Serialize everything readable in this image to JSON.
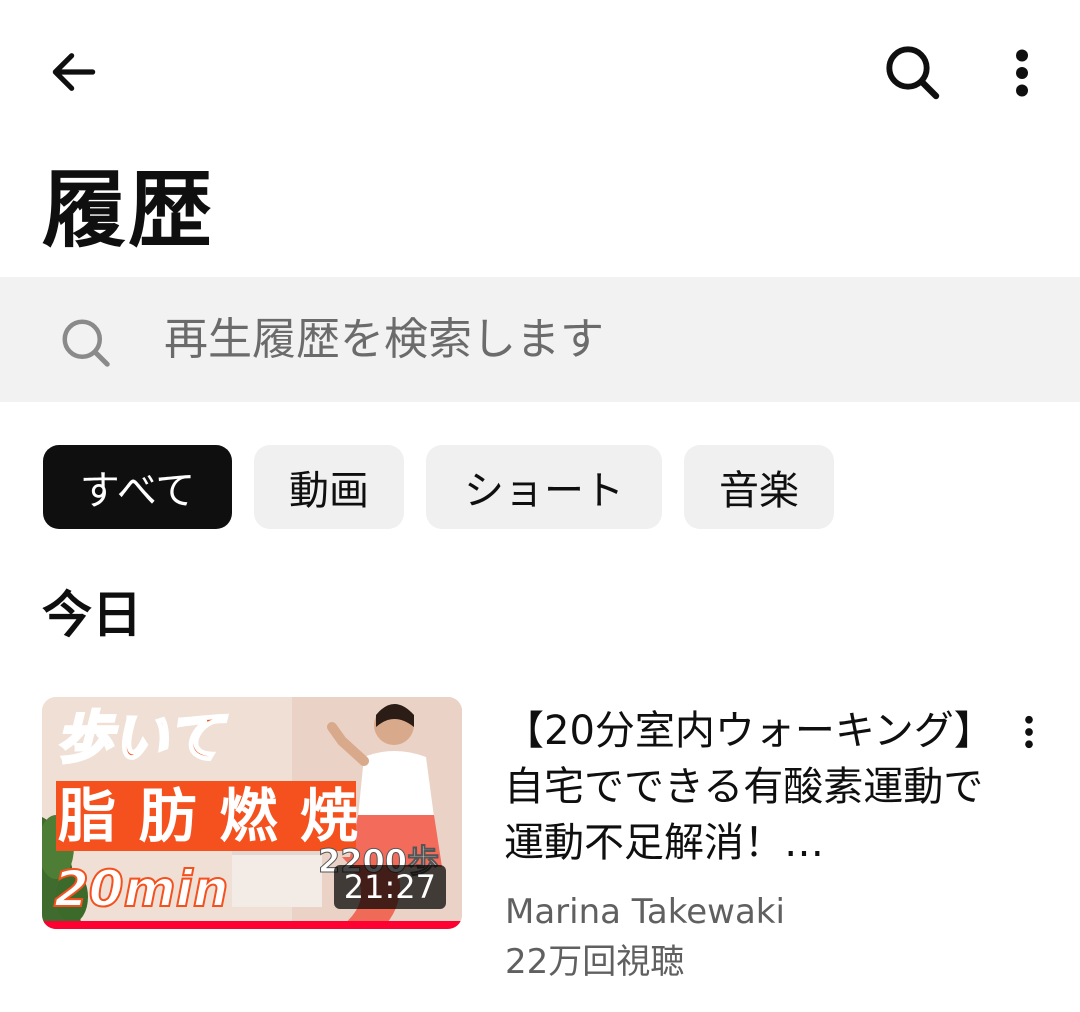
{
  "header": {
    "back_icon": "arrow-left-icon",
    "search_icon": "search-icon",
    "more_icon": "more-vertical-icon",
    "title": "履歴"
  },
  "search": {
    "placeholder": "再生履歴を検索します",
    "icon": "search-icon"
  },
  "filters": [
    {
      "label": "すべて",
      "selected": true
    },
    {
      "label": "動画",
      "selected": false
    },
    {
      "label": "ショート",
      "selected": false
    },
    {
      "label": "音楽",
      "selected": false
    }
  ],
  "sections": [
    {
      "title": "今日",
      "videos": [
        {
          "thumbnail": {
            "text_top": "歩いて",
            "text_main": [
              "脂",
              "肪",
              "燃",
              "焼"
            ],
            "text_bottom": "20min",
            "text_steps": "2200歩",
            "duration": "21:27",
            "watch_progress": 1.0
          },
          "title": "【20分室内ウォーキング】自宅でできる有酸素運動で運動不足解消！…",
          "channel": "Marina Takewaki",
          "views": "22万回視聴",
          "more_icon": "more-vertical-icon"
        }
      ]
    }
  ],
  "colors": {
    "accent_red": "#ff0033",
    "thumb_orange": "#f4511e",
    "chip_active_bg": "#0f0f0f",
    "chip_bg": "#f0f0f0",
    "search_bg": "#f2f2f2",
    "secondary_text": "#606060"
  }
}
